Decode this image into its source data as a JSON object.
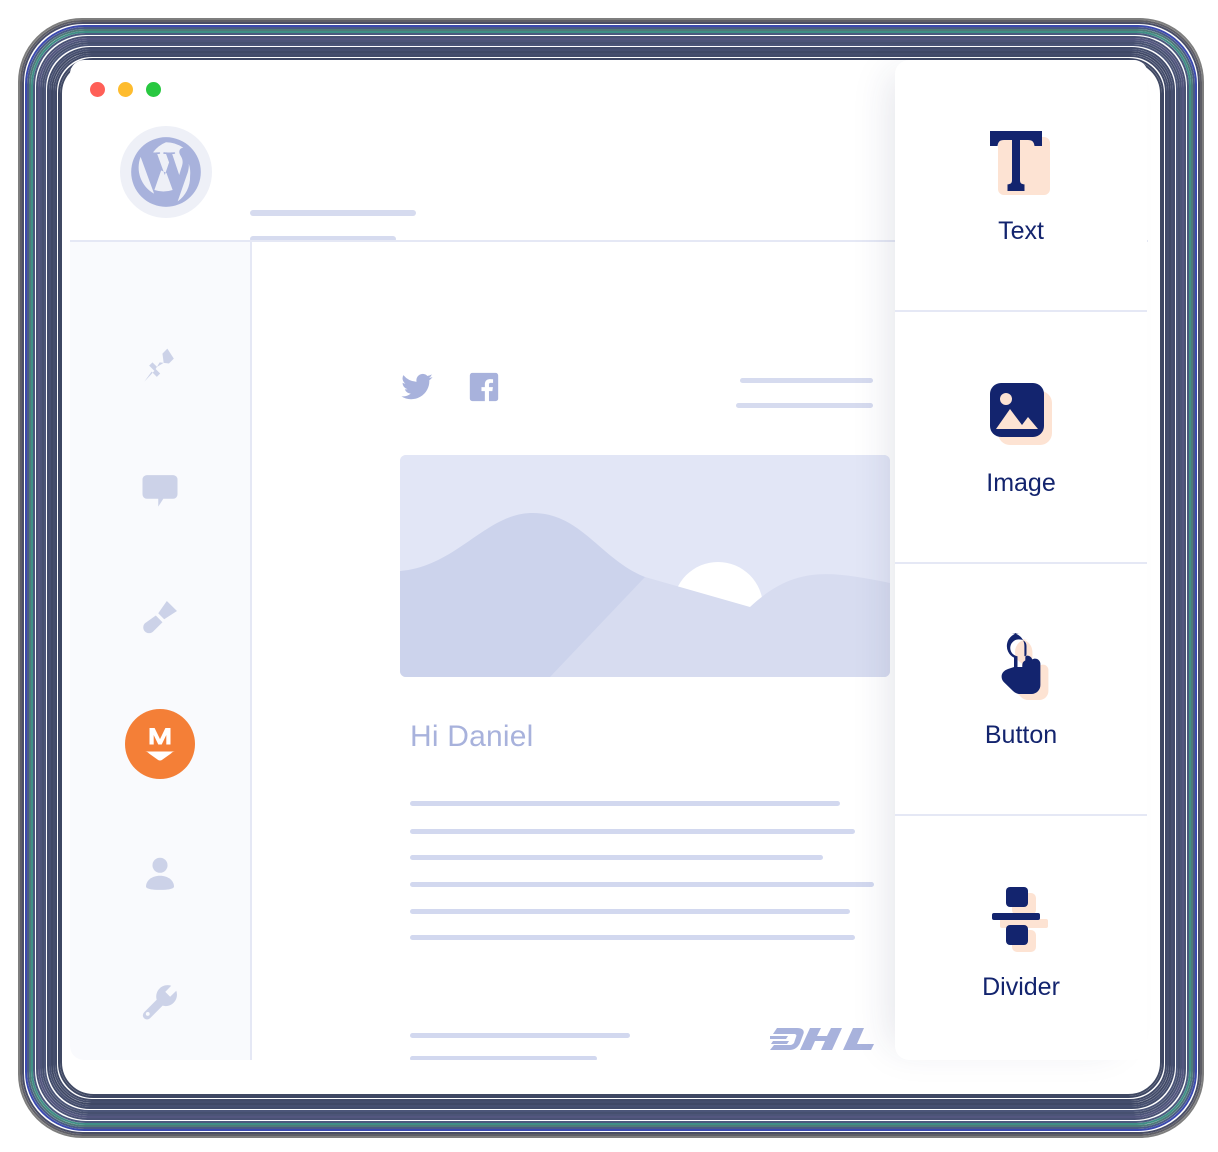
{
  "window": {
    "traffic_lights": [
      {
        "name": "close",
        "color": "#ff5f57"
      },
      {
        "name": "minimize",
        "color": "#febc2e"
      },
      {
        "name": "maximize",
        "color": "#28c840"
      }
    ]
  },
  "header": {
    "logo_icon": "wordpress-icon",
    "placeholder_bars": 2
  },
  "sidebar": {
    "items": [
      {
        "icon": "pin-icon",
        "name": "pin",
        "active": false
      },
      {
        "icon": "comment-icon",
        "name": "comments",
        "active": false
      },
      {
        "icon": "paintbrush-icon",
        "name": "appearance",
        "active": false
      },
      {
        "icon": "mailpoet-icon",
        "name": "mailpoet",
        "active": true
      },
      {
        "icon": "user-icon",
        "name": "users",
        "active": false
      },
      {
        "icon": "wrench-icon",
        "name": "tools",
        "active": false
      }
    ],
    "active_color": "#f47f37"
  },
  "email": {
    "social_icons": [
      {
        "icon": "twitter-icon",
        "name": "twitter"
      },
      {
        "icon": "facebook-icon",
        "name": "facebook"
      }
    ],
    "hero_image_alt": "landscape-placeholder",
    "greeting": "Hi Daniel",
    "body_line_count": 6,
    "footer_line_count": 2,
    "footer_logo": "DHL"
  },
  "blocks_panel": {
    "items": [
      {
        "label": "Text",
        "icon": "text-block-icon"
      },
      {
        "label": "Image",
        "icon": "image-block-icon"
      },
      {
        "label": "Button",
        "icon": "button-block-icon"
      },
      {
        "label": "Divider",
        "icon": "divider-block-icon"
      }
    ],
    "icon_color": "#13246e",
    "icon_shadow_color": "#fde3d3"
  },
  "frame": {
    "ring_colors": [
      "#7e7e7e",
      "#5e5e66",
      "#4a4e66",
      "#3b4ab0",
      "#4a5a86",
      "#4e7a78",
      "#3f8f86",
      "#4b5a7e",
      "#4a5275",
      "#53567f",
      "#4c5478",
      "#46506f",
      "#4b5578",
      "#424c6b",
      "#464f70",
      "#3f4865",
      "#444d6c",
      "#414a68",
      "#3e4764",
      "#404963"
    ]
  },
  "palette": {
    "accent_orange": "#f47f37",
    "skeleton": "#d6dbef",
    "periwinkle": "#a8b2dc",
    "navy": "#13246e",
    "peach": "#fde3d3"
  }
}
